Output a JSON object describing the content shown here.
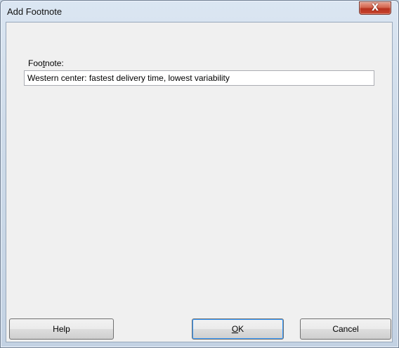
{
  "window": {
    "title": "Add Footnote",
    "close_glyph": "X"
  },
  "form": {
    "footnote_label_prefix": "Foo",
    "footnote_label_accel": "t",
    "footnote_label_suffix": "note:",
    "footnote_value": "Western center: fastest delivery time, lowest variability"
  },
  "buttons": {
    "help_label": "Help",
    "ok_label_accel": "O",
    "ok_label_rest": "K",
    "cancel_label": "Cancel"
  },
  "colors": {
    "client_bg": "#f0f0f0",
    "close_button": "#c9472f",
    "default_button_focus": "#3399ff"
  }
}
